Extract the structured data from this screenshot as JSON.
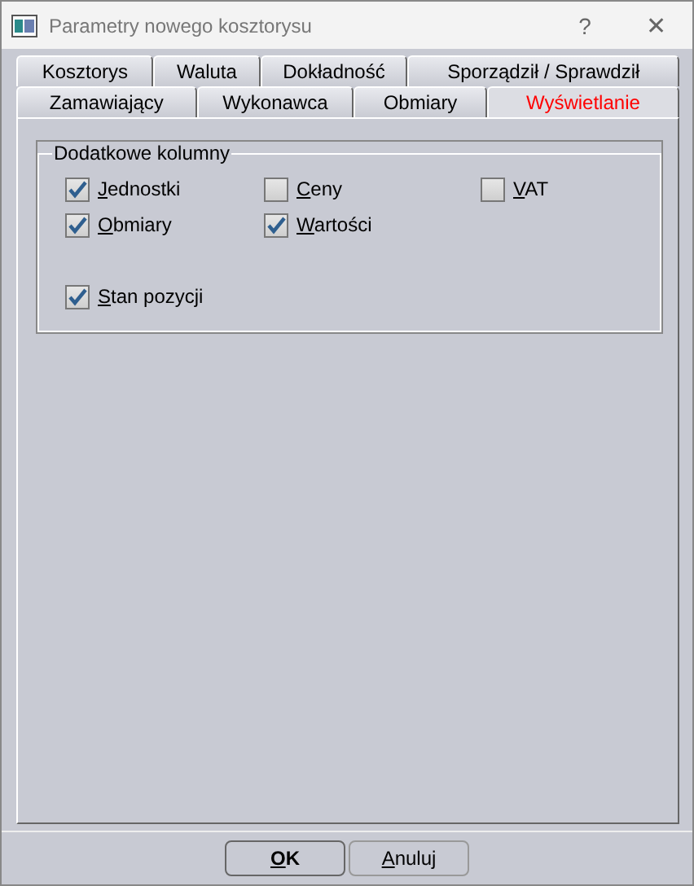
{
  "window": {
    "title": "Parametry nowego kosztorysu",
    "help": "?",
    "close": "✕"
  },
  "tab_rows": [
    [
      {
        "label": "Kosztorys",
        "selected": false
      },
      {
        "label": "Waluta",
        "selected": false
      },
      {
        "label": "Dokładność",
        "selected": false
      },
      {
        "label": "Sporządził / Sprawdził",
        "selected": false
      }
    ],
    [
      {
        "label": "Zamawiający",
        "selected": false
      },
      {
        "label": "Wykonawca",
        "selected": false
      },
      {
        "label": "Obmiary",
        "selected": false
      },
      {
        "label": "Wyświetlanie",
        "selected": true
      }
    ]
  ],
  "group": {
    "title": "Dodatkowe kolumny",
    "rows": [
      [
        {
          "label": "Jednostki",
          "checked": true
        },
        {
          "label": "Ceny",
          "checked": false
        },
        {
          "label": "VAT",
          "checked": false
        }
      ],
      [
        {
          "label": "Obmiary",
          "checked": true
        },
        {
          "label": "Wartości",
          "checked": true
        }
      ],
      [],
      [
        {
          "label": "Stan pozycji",
          "checked": true
        }
      ]
    ]
  },
  "buttons": [
    {
      "label": "OK",
      "default": true
    },
    {
      "label": "Anuluj",
      "default": false
    }
  ]
}
